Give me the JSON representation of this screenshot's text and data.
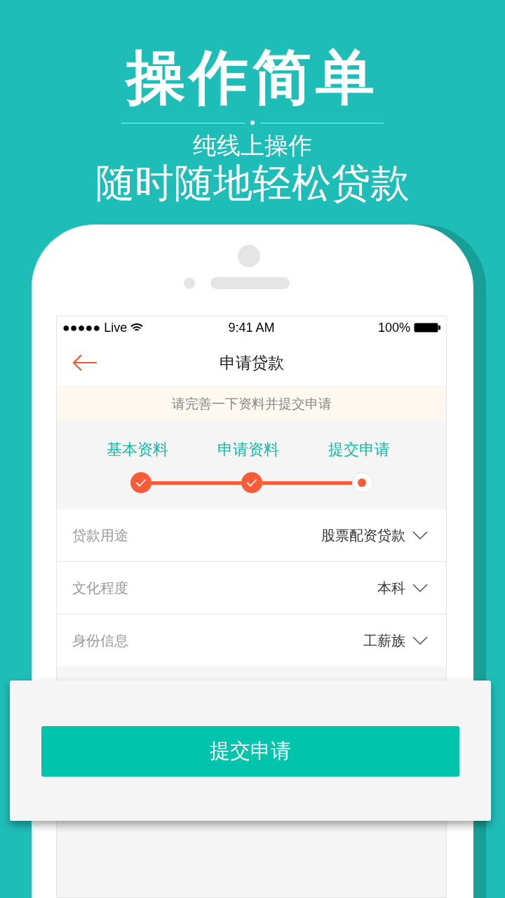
{
  "promo": {
    "headline": "操作简单",
    "subtitle": "纯线上操作",
    "tagline": "随时随地轻松贷款"
  },
  "status_bar": {
    "carrier": "●●●●● Live",
    "time": "9:41 AM",
    "battery": "100%"
  },
  "nav": {
    "title": "申请贷款"
  },
  "notice": "请完善一下资料并提交申请",
  "steps": [
    {
      "label": "基本资料",
      "done": true
    },
    {
      "label": "申请资料",
      "done": true
    },
    {
      "label": "提交申请",
      "done": false
    }
  ],
  "fields": [
    {
      "label": "贷款用途",
      "value": "股票配资贷款"
    },
    {
      "label": "文化程度",
      "value": "本科"
    },
    {
      "label": "身份信息",
      "value": "工薪族"
    }
  ],
  "submit_button": "提交申请"
}
